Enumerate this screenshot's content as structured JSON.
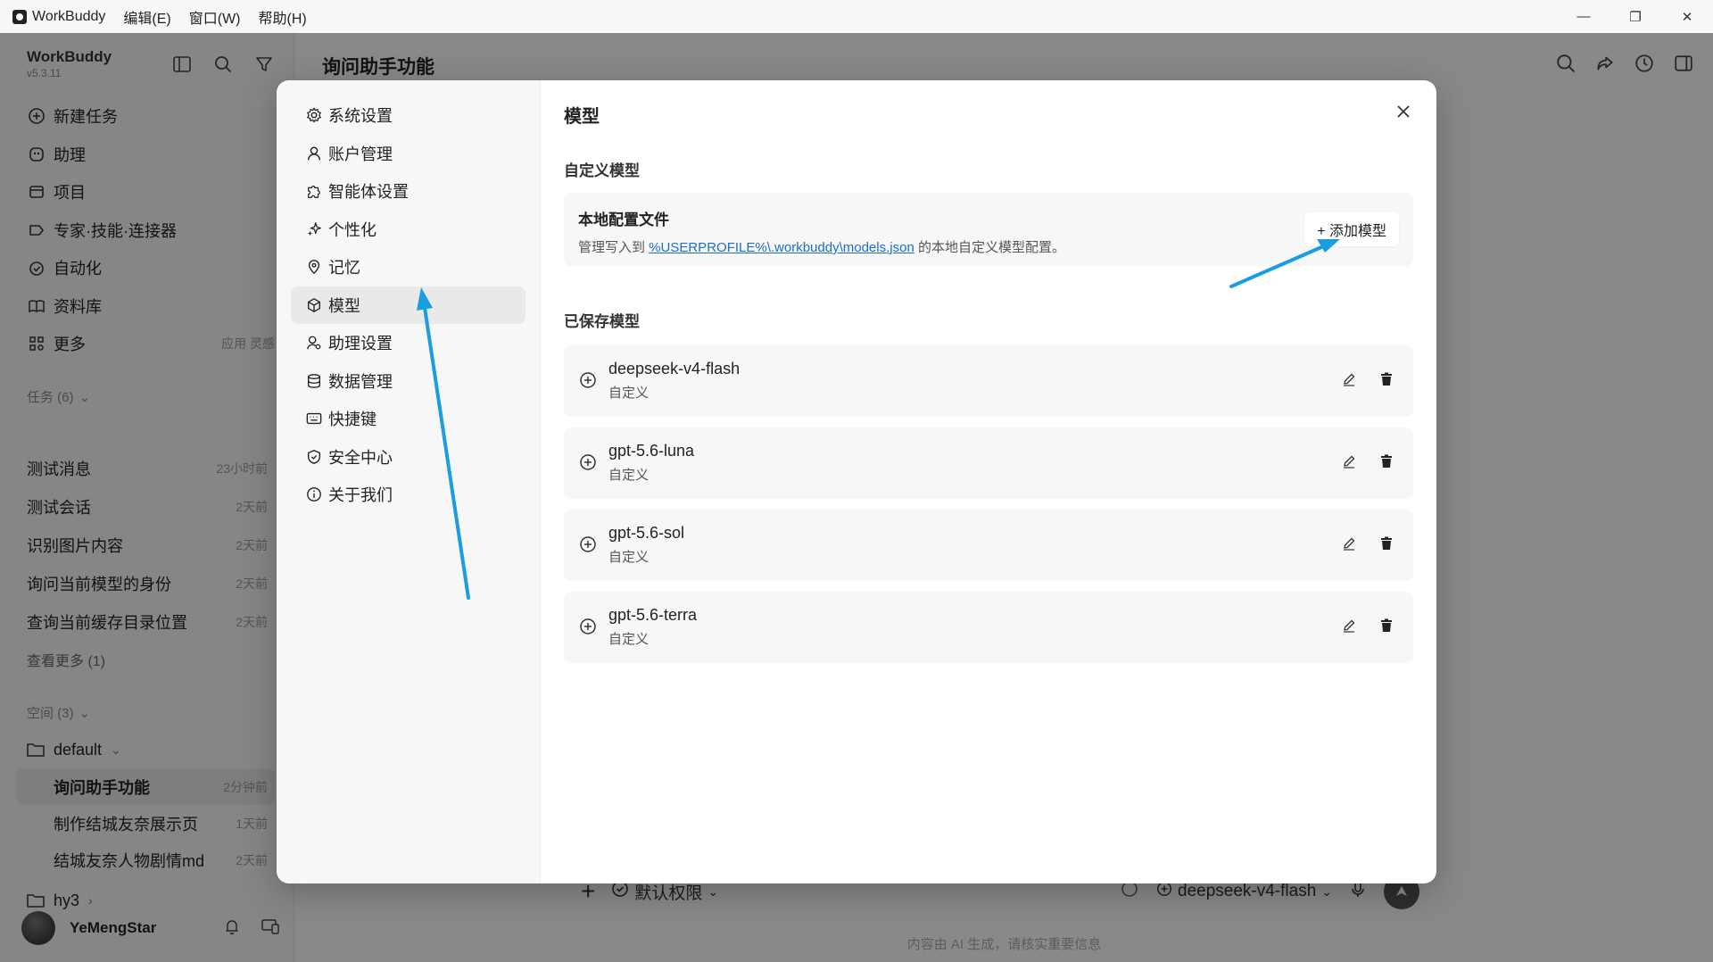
{
  "titlebar": {
    "app_name": "WorkBuddy",
    "menus": [
      "编辑(E)",
      "窗口(W)",
      "帮助(H)"
    ],
    "minimize": "—",
    "restore": "❐",
    "close": "✕"
  },
  "sidebar": {
    "brand": "WorkBuddy",
    "version": "v5.3.11",
    "nav": [
      {
        "label": "新建任务",
        "icon": "plus-circle-icon"
      },
      {
        "label": "助理",
        "icon": "assistant-icon"
      },
      {
        "label": "项目",
        "icon": "project-icon"
      },
      {
        "label": "专家·技能·连接器",
        "icon": "expert-icon"
      },
      {
        "label": "自动化",
        "icon": "automation-icon"
      },
      {
        "label": "资料库",
        "icon": "library-icon"
      },
      {
        "label": "更多",
        "icon": "more-grid-icon",
        "extra": "应用 灵感"
      }
    ],
    "tasks_header": "任务 (6)",
    "tasks": [
      {
        "title": "测试消息",
        "time": "23小时前"
      },
      {
        "title": "测试会话",
        "time": "2天前"
      },
      {
        "title": "识别图片内容",
        "time": "2天前"
      },
      {
        "title": "询问当前模型的身份",
        "time": "2天前"
      },
      {
        "title": "查询当前缓存目录位置",
        "time": "2天前"
      }
    ],
    "more_tasks": "查看更多 (1)",
    "spaces_header": "空间 (3)",
    "space_default": "default",
    "space_items": [
      {
        "title": "询问助手功能",
        "time": "2分钟前",
        "active": true
      },
      {
        "title": "制作结城友奈展示页",
        "time": "1天前"
      },
      {
        "title": "结城友奈人物剧情md",
        "time": "2天前"
      }
    ],
    "space_hy3": "hy3",
    "user_name": "YeMengStar"
  },
  "main": {
    "title": "询问助手功能",
    "composer_perm": "默认权限",
    "composer_model": "deepseek-v4-flash",
    "footnote": "内容由 AI 生成，请核实重要信息"
  },
  "modal": {
    "nav": [
      {
        "label": "系统设置",
        "icon": "gear-icon"
      },
      {
        "label": "账户管理",
        "icon": "user-icon"
      },
      {
        "label": "智能体设置",
        "icon": "puzzle-icon"
      },
      {
        "label": "个性化",
        "icon": "sparkle-icon"
      },
      {
        "label": "记忆",
        "icon": "memory-icon"
      },
      {
        "label": "模型",
        "icon": "cube-icon",
        "active": true
      },
      {
        "label": "助理设置",
        "icon": "assistant-settings-icon"
      },
      {
        "label": "数据管理",
        "icon": "database-icon"
      },
      {
        "label": "快捷键",
        "icon": "keyboard-icon"
      },
      {
        "label": "安全中心",
        "icon": "shield-icon"
      },
      {
        "label": "关于我们",
        "icon": "info-icon"
      }
    ],
    "title": "模型",
    "custom_section": "自定义模型",
    "config_title": "本地配置文件",
    "config_desc_prefix": "管理写入到 ",
    "config_path": "%USERPROFILE%\\.workbuddy\\models.json",
    "config_desc_suffix": " 的本地自定义模型配置。",
    "add_button": "+ 添加模型",
    "saved_section": "已保存模型",
    "models": [
      {
        "name": "deepseek-v4-flash",
        "tag": "自定义"
      },
      {
        "name": "gpt-5.6-luna",
        "tag": "自定义"
      },
      {
        "name": "gpt-5.6-sol",
        "tag": "自定义"
      },
      {
        "name": "gpt-5.6-terra",
        "tag": "自定义"
      }
    ]
  },
  "colors": {
    "annotation_arrow": "#1a9ee0",
    "link": "#1b6fc9"
  }
}
